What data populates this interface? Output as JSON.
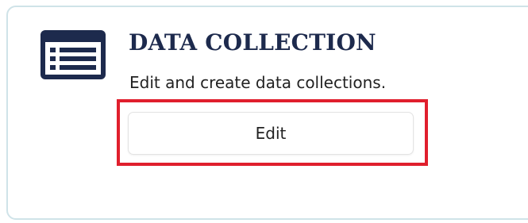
{
  "card": {
    "icon": "list-window-icon",
    "title": "DATA COLLECTION",
    "description": "Edit and create data collections.",
    "edit_label": "Edit"
  },
  "colors": {
    "title": "#1d2a4d",
    "icon": "#1d2a4d",
    "highlight": "#e01f2d",
    "card_border": "#cfe3e8"
  }
}
